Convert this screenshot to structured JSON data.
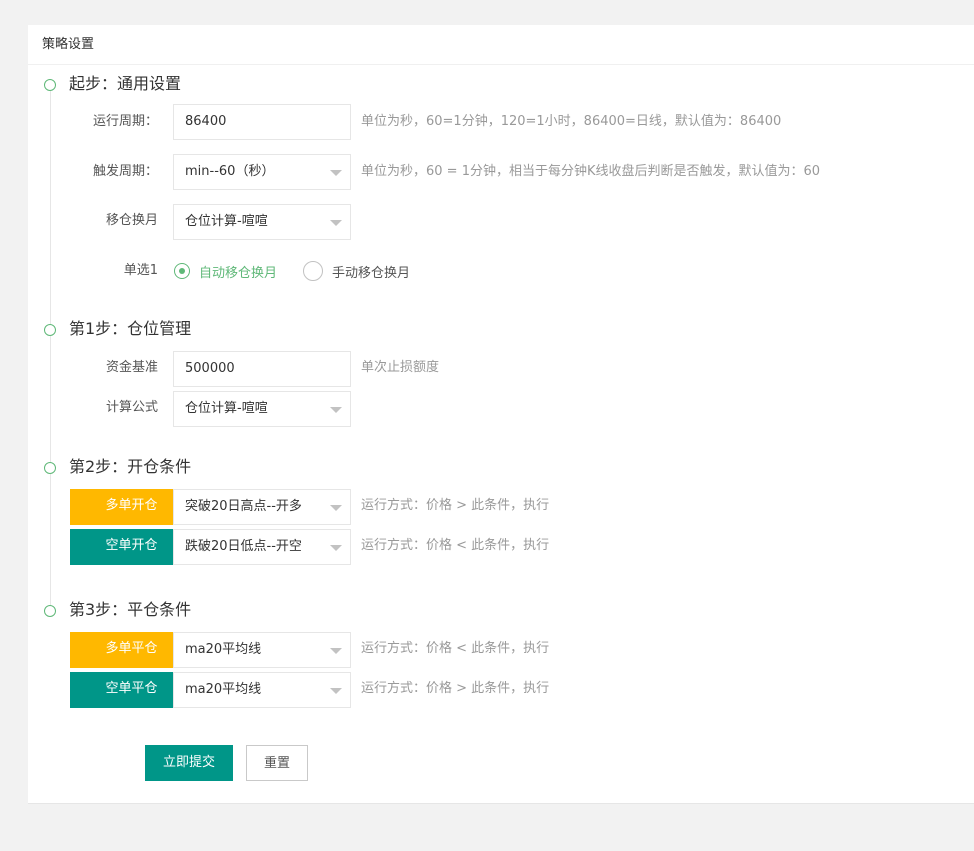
{
  "header": {
    "title": "策略设置"
  },
  "colors": {
    "orange": "#ffb800",
    "teal": "#009688",
    "green": "#5fb878"
  },
  "step0": {
    "title": "起步：通用设置",
    "run_period": {
      "label": "运行周期：",
      "value": "86400",
      "hint": "单位为秒，60=1分钟，120=1小时，86400=日线，默认值为：86400"
    },
    "trigger_period": {
      "label": "触发周期：",
      "value": "min--60（秒）",
      "hint": "单位为秒，60 = 1分钟，相当于每分钟K线收盘后判断是否触发，默认值为：60"
    },
    "roll": {
      "label": "移仓换月",
      "value": "仓位计算-喧喧"
    },
    "radio": {
      "label": "单选1",
      "option1": "自动移仓换月",
      "option2": "手动移仓换月"
    }
  },
  "step1": {
    "title": "第1步：仓位管理",
    "capital": {
      "label": "资金基准",
      "value": "500000",
      "hint": "单次止损额度"
    },
    "formula": {
      "label": "计算公式",
      "value": "仓位计算-喧喧"
    }
  },
  "step2": {
    "title": "第2步：开仓条件",
    "long": {
      "tag": "多单开仓",
      "value": "突破20日高点--开多",
      "hint": "运行方式：价格 > 此条件，执行"
    },
    "short": {
      "tag": "空单开仓",
      "value": "跌破20日低点--开空",
      "hint": "运行方式：价格 < 此条件，执行"
    }
  },
  "step3": {
    "title": "第3步：平仓条件",
    "long": {
      "tag": "多单平仓",
      "value": "ma20平均线",
      "hint": "运行方式：价格 < 此条件，执行"
    },
    "short": {
      "tag": "空单平仓",
      "value": "ma20平均线",
      "hint": "运行方式：价格 > 此条件，执行"
    }
  },
  "actions": {
    "submit": "立即提交",
    "reset": "重置"
  }
}
